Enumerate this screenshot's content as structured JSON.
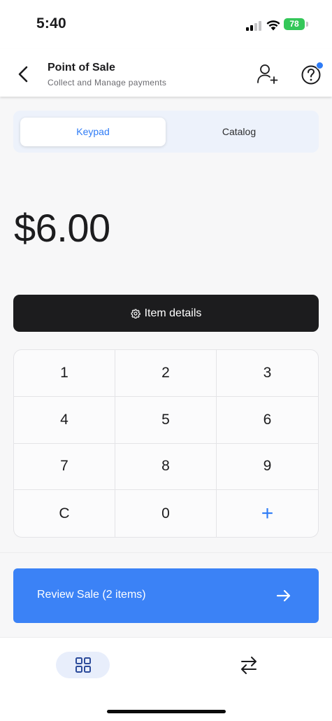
{
  "status_bar": {
    "time": "5:40",
    "battery": "78"
  },
  "header": {
    "title": "Point of Sale",
    "subtitle": "Collect and Manage payments",
    "icons": [
      "back-icon",
      "add-user-icon",
      "help-icon"
    ]
  },
  "tabs": {
    "keypad": "Keypad",
    "catalog": "Catalog",
    "active": "Keypad"
  },
  "amount": "$6.00",
  "item_details": {
    "label": "Item details",
    "icon": "gear-icon"
  },
  "keypad": {
    "keys": [
      "1",
      "2",
      "3",
      "4",
      "5",
      "6",
      "7",
      "8",
      "9",
      "C",
      "0",
      "+"
    ]
  },
  "review_sale": {
    "label": "Review Sale (2 items)",
    "icon": "arrow-right-icon"
  },
  "bottom_nav": {
    "items": [
      "grid-icon",
      "swap-arrows-icon"
    ],
    "active": "grid-icon"
  },
  "colors": {
    "accent": "#2f7cf6",
    "review_button": "#3b82f6",
    "dark_button": "#1c1c1e",
    "battery": "#34c759",
    "tab_track": "#edf2fb"
  }
}
